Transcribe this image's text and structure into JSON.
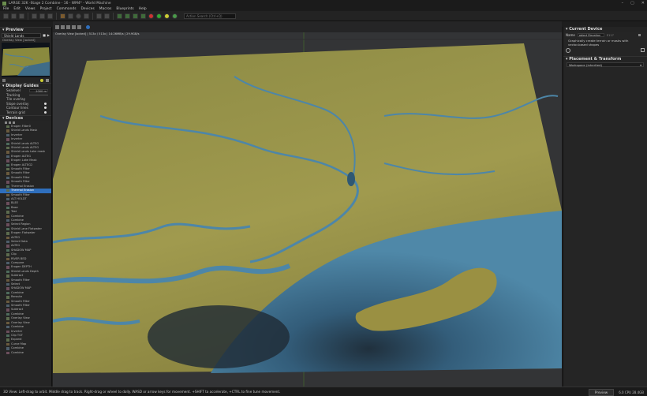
{
  "window": {
    "title": "LARGE 32K -Stage 2 Combine - 16 - WM4* - World Machine"
  },
  "menu": [
    "File",
    "Edit",
    "Views",
    "Project",
    "Commands",
    "Devices",
    "Macros",
    "Blueprints",
    "Help"
  ],
  "toolbar": {
    "search_placeholder": "Action Search (Ctrl+Q)"
  },
  "left": {
    "preview_header": "Preview",
    "preview_select": "Shield Lands",
    "overlay_label": "Overlay View [locked]",
    "display_guides_header": "Display Guides",
    "sealevel_label": "Sealevel",
    "sealevel_value": "-1000 m",
    "tracking_label": "Tracking",
    "tile_overlay_label": "Tile overlay",
    "slope_overlay_label": "Slope overlay",
    "contour_lines_label": "Contour lines",
    "terrain_grid_label": "Terrain grid",
    "devices_header": "Devices",
    "devices": [
      "Erogen Filter0",
      "Shield Lands Mask",
      "Inverter",
      "Inverter",
      "Shield Lands ALTEG",
      "Shield Lands ALTEG",
      "Shield Lands Lake mask",
      "Erogen ALTEG",
      "Erogen Lake Mask",
      "Erogen ALTEG2",
      "Smooth Filter",
      "Smooth Filter",
      "Smooth Filter",
      "Smooth Filter",
      "Thermal Erosion",
      "Thermal Erosion",
      "Smooth Filter",
      "ALT HOLDT",
      "BLEE",
      "Base",
      "Test",
      "Combine",
      "Combine",
      "Select Region",
      "Shield Lane Flatwater",
      "Erogen Flatwater",
      "ALTEG",
      "Select Data",
      "ALTEG",
      "SHADOW MAP",
      "Clip",
      "RIVER BED",
      "Compare",
      "Erogen DEPTH",
      "Shield Lands Depth",
      "Subtract",
      "Smooth Filter",
      "Select",
      "SHADOW MAP",
      "Combine",
      "Reroute",
      "Smooth Filter",
      "Smooth Filter",
      "Subtract",
      "Combine",
      "Overlay View",
      "Overlay View",
      "Combine",
      "Inverter",
      "Clip TGT",
      "Expand",
      "Curve Map",
      "Combine",
      "Combine"
    ],
    "selected_device_index": 15
  },
  "viewport": {
    "header": "Overlay View [locked] | 513x / 513x | 14:26MB/s | 29.9GB/s"
  },
  "right": {
    "current_device_header": "Current Device",
    "name_label": "Name",
    "name_value": "object Elevation",
    "name_id": "E117",
    "description": "Graphically create terrain or masks with vector-based shapes",
    "placement_header": "Placement & Transform",
    "workspace_select": "Workspace (inherited)"
  },
  "status": {
    "hint": "3D View: Left-drag to orbit. Middle drag to track. Right-drag or wheel to dolly. WASD or arrow keys for movement. +SHIFT to accelerate, +CTRL to fine tune movement.",
    "preview_button": "Preview",
    "usage": "6.0 CPU 28.4GB"
  }
}
